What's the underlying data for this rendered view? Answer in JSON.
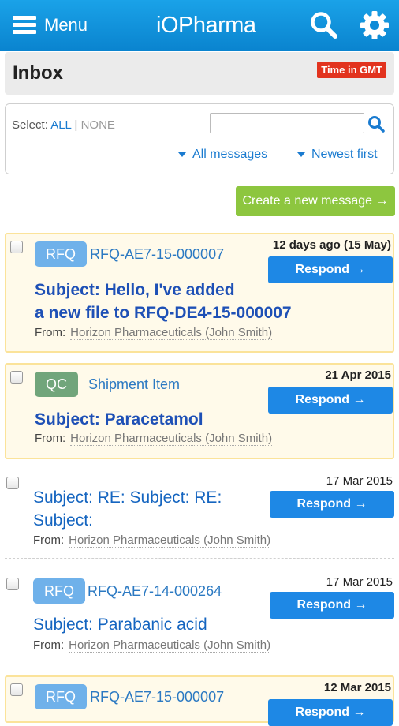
{
  "header": {
    "menu_label": "Menu",
    "logo": "iOPharma",
    "icons": {
      "menu": "hamburger-icon",
      "search": "search-icon",
      "settings": "gear-icon"
    }
  },
  "inbox": {
    "title": "Inbox",
    "time_badge": "Time in GMT"
  },
  "filter": {
    "select_label": "Select:",
    "all": "ALL",
    "separator": "|",
    "none": "NONE",
    "search_placeholder": "",
    "messages_filter": "All messages",
    "sort_order": "Newest first"
  },
  "create_button": "Create a new message →",
  "messages": [
    {
      "tag": "RFQ",
      "ref": "RFQ-AE7-15-000007",
      "date": "12 days ago (15 May)",
      "respond": "Respond →",
      "subject_line1": "Subject: Hello, I've added",
      "subject_line2": "a new file to RFQ-DE4-15-000007",
      "from_label": "From:",
      "from": "Horizon Pharmaceuticals (John Smith)"
    },
    {
      "tag": "QC",
      "ref": "Shipment Item",
      "date": "21 Apr 2015",
      "respond": "Respond →",
      "subject_line1": "Subject: Paracetamol",
      "from_label": "From:",
      "from": "Horizon Pharmaceuticals (John Smith)"
    },
    {
      "date": "17 Mar 2015",
      "respond": "Respond →",
      "subject_line1": "Subject: RE: Subject: RE:",
      "subject_line2": "Subject:",
      "from_label": "From:",
      "from": "Horizon Pharmaceuticals (John Smith)"
    },
    {
      "tag": "RFQ",
      "ref": "RFQ-AE7-14-000264",
      "date": "17 Mar 2015",
      "respond": "Respond →",
      "subject_line1": "Subject: Parabanic acid",
      "from_label": "From:",
      "from": "Horizon Pharmaceuticals (John Smith)"
    },
    {
      "tag": "RFQ",
      "ref": "RFQ-AE7-15-000007",
      "date": "12 Mar 2015",
      "respond": "Respond →"
    }
  ],
  "colors": {
    "header_blue": "#0a84cf",
    "accent_blue": "#1e88e5",
    "create_green": "#8dc63f",
    "gmt_red": "#e2331e",
    "highlight_bg": "#fffaea",
    "highlight_border": "#fbe39a",
    "tag_rfq": "#6fb1ea",
    "tag_qc": "#71a57b"
  }
}
